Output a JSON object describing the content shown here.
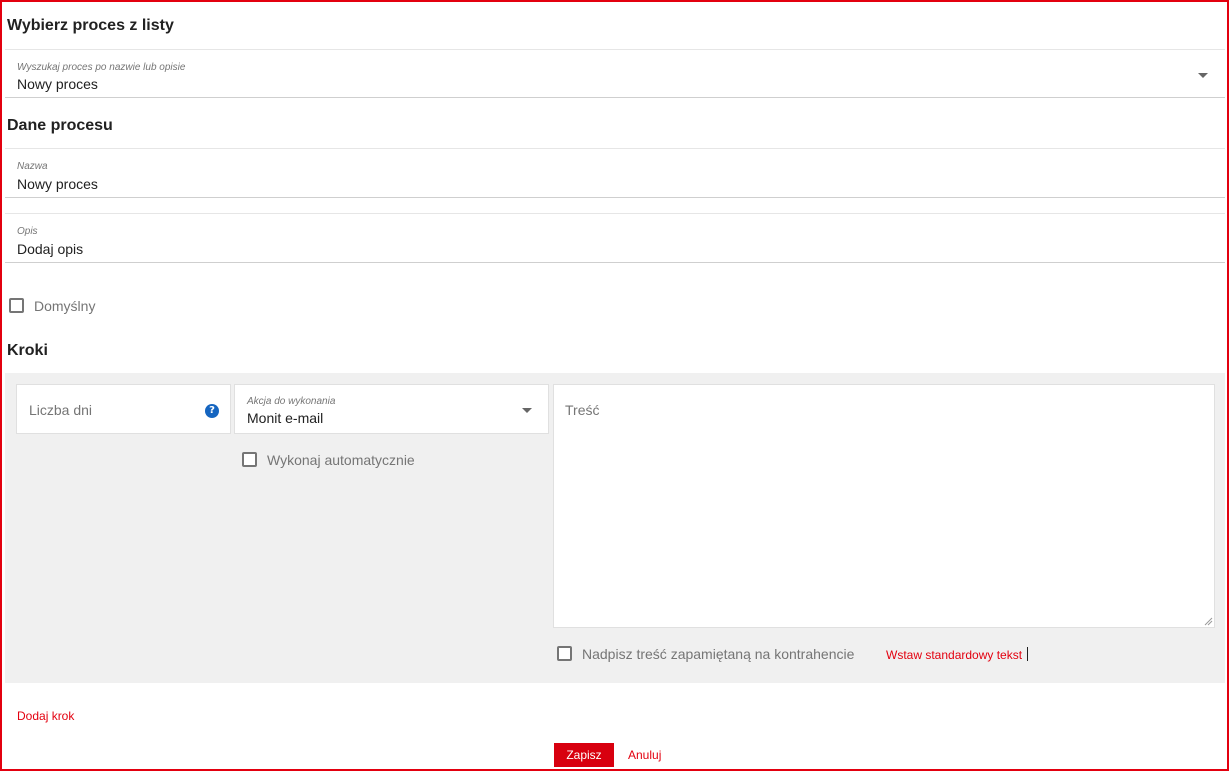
{
  "sections": {
    "select_title": "Wybierz proces z listy",
    "data_title": "Dane procesu",
    "steps_title": "Kroki"
  },
  "process_select": {
    "label": "Wyszukaj proces po nazwie lub opisie",
    "value": "Nowy proces",
    "icon": "chevron-down-icon"
  },
  "name_field": {
    "label": "Nazwa",
    "value": "Nowy proces"
  },
  "description_field": {
    "label": "Opis",
    "value": "Dodaj opis"
  },
  "default_checkbox": {
    "label": "Domyślny",
    "checked": false
  },
  "step": {
    "days_placeholder": "Liczba dni",
    "help_icon": "question-circle-icon",
    "action_label": "Akcja do wykonania",
    "action_value": "Monit e-mail",
    "auto_checkbox_label": "Wykonaj automatycznie",
    "content_placeholder": "Treść",
    "overwrite_checkbox_label": "Nadpisz treść zapamiętaną na kontrahencie",
    "insert_standard_link": "Wstaw standardowy tekst"
  },
  "add_step_link": "Dodaj krok",
  "buttons": {
    "save": "Zapisz",
    "cancel": "Anuluj"
  },
  "colors": {
    "accent": "#e3000f",
    "help_icon": "#1565c0",
    "panel_bg": "#f0f0f0"
  }
}
